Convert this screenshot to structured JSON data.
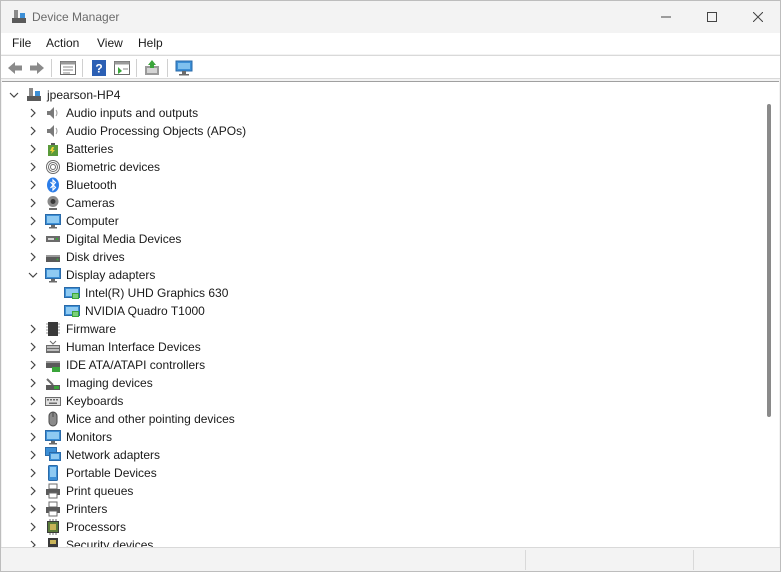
{
  "window": {
    "title": "Device Manager"
  },
  "menu": [
    "File",
    "Action",
    "View",
    "Help"
  ],
  "tree": {
    "root": "jpearson-HP4",
    "categories": [
      "Audio inputs and outputs",
      "Audio Processing Objects (APOs)",
      "Batteries",
      "Biometric devices",
      "Bluetooth",
      "Cameras",
      "Computer",
      "Digital Media Devices",
      "Disk drives",
      "Display adapters",
      "Firmware",
      "Human Interface Devices",
      "IDE ATA/ATAPI controllers",
      "Imaging devices",
      "Keyboards",
      "Mice and other pointing devices",
      "Monitors",
      "Network adapters",
      "Portable Devices",
      "Print queues",
      "Printers",
      "Processors",
      "Security devices"
    ],
    "display_children": [
      "Intel(R) UHD Graphics 630",
      "NVIDIA Quadro T1000"
    ]
  },
  "icons": {
    "back": "back-arrow-icon",
    "forward": "forward-arrow-icon",
    "properties": "properties-icon",
    "help": "help-icon",
    "action": "show-hide-icon",
    "update": "update-driver-icon",
    "scan": "scan-hardware-icon"
  },
  "colors": {
    "accent": "#2b7de9",
    "icon_blue": "#3c8fd6",
    "icon_gray": "#6b6b6b"
  }
}
